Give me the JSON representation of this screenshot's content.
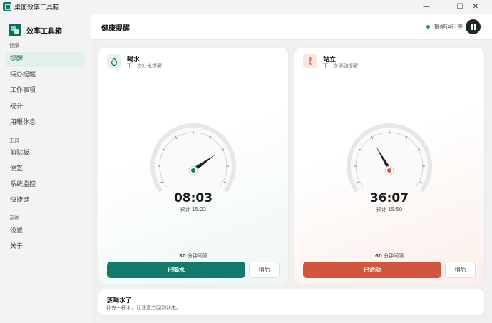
{
  "window": {
    "title": "桌面效率工具箱",
    "minimize": "—",
    "maximize": "☐",
    "close": "✕"
  },
  "sidebar": {
    "brand": "效率工具箱",
    "sections": [
      {
        "label": "健康",
        "items": [
          {
            "label": "提醒",
            "active": true
          },
          {
            "label": "待办提醒"
          },
          {
            "label": "工作事项"
          },
          {
            "label": "统计"
          },
          {
            "label": "用眼休息"
          }
        ]
      },
      {
        "label": "工具",
        "items": [
          {
            "label": "剪贴板"
          },
          {
            "label": "便签"
          },
          {
            "label": "系统监控"
          },
          {
            "label": "快捷键"
          }
        ]
      },
      {
        "label": "系统",
        "items": [
          {
            "label": "设置"
          },
          {
            "label": "关于"
          }
        ]
      }
    ]
  },
  "header": {
    "title": "健康提醒",
    "status": "提醒运行中",
    "status_color": "#1a9a58"
  },
  "cards": {
    "water": {
      "icon": "droplet-icon",
      "title": "喝水",
      "subtitle": "下一次补水提醒",
      "time": "08:03",
      "eta": "预计 15:22",
      "interval_value": "30",
      "interval_unit": "分钟间隔",
      "primary": "已喝水",
      "later": "稍后",
      "accent": "#127a6a",
      "remaining_fraction": 0.27
    },
    "stand": {
      "icon": "standing-person-icon",
      "title": "站立",
      "subtitle": "下一次活动提醒",
      "time": "36:07",
      "eta": "预计 15:50",
      "interval_value": "60",
      "interval_unit": "分钟间隔",
      "primary": "已活动",
      "later": "稍后",
      "accent": "#d2553e",
      "remaining_fraction": 0.6
    }
  },
  "bottom": {
    "title": "该喝水了",
    "subtitle": "补充一杯水，让注意力回到状态。"
  }
}
